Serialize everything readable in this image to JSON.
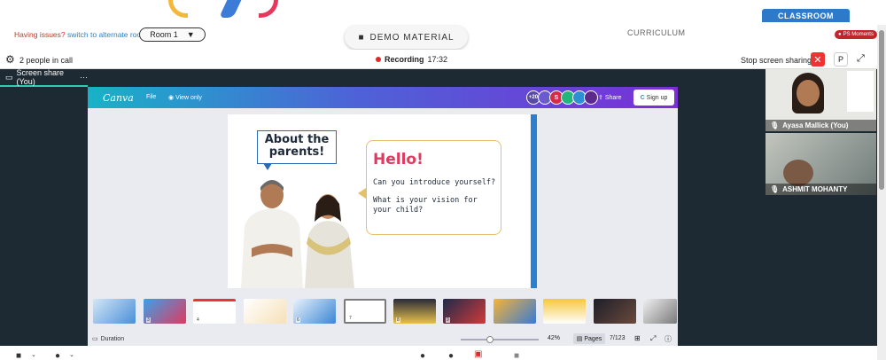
{
  "header": {
    "issues_text": "Having issues?",
    "issues_link": "switch to alternate room",
    "room_label": "Room 1",
    "demo_material": "DEMO MATERIAL",
    "curriculum": "CURRICULUM",
    "classroom": "CLASSROOM",
    "ps_moments": "PS Moments"
  },
  "callbar": {
    "people": "2 people in call",
    "recording_label": "Recording",
    "recording_time": "17:32",
    "stop_sharing": "Stop screen sharing",
    "p_button": "P"
  },
  "screenshare": {
    "tab_label": "Screen share (You)"
  },
  "canva": {
    "logo": "Canva",
    "file": "File",
    "view_only": "View only",
    "avatar_count": "+20",
    "avatar_s": "S",
    "share": "Share",
    "sign_up": "Sign up",
    "slide": {
      "about": "About the parents!",
      "hello": "Hello!",
      "q1": "Can you introduce yourself?",
      "q2": "What is your vision for your child?"
    },
    "thumbnail_numbers": [
      "",
      "3",
      "4",
      "",
      "6",
      "7",
      "8",
      "9",
      "",
      "",
      "",
      ""
    ],
    "footer": {
      "duration": "Duration",
      "zoom": "42%",
      "pages": "Pages",
      "page_count": "7/123"
    }
  },
  "participants": [
    {
      "name": "Ayasa Mallick (You)"
    },
    {
      "name": "ASHMIT MOHANTY"
    }
  ],
  "colors": {
    "accent_blue": "#2f7ac8",
    "record_red": "#e02a2a",
    "hello_pink": "#e03a5f",
    "teal_underline": "#2ecfb0"
  }
}
